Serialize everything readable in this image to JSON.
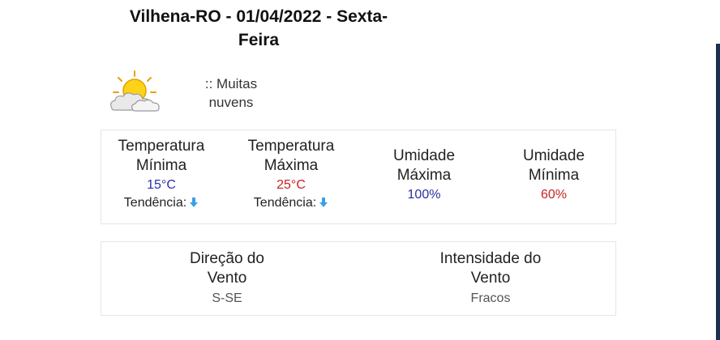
{
  "header": {
    "title_line1": "Vilhena-RO - 01/04/2022 - Sexta-",
    "title_line2": "Feira"
  },
  "condition": {
    "icon": "sun-behind-clouds-icon",
    "line1": ":: Muitas",
    "line2": "nuvens"
  },
  "temperatures": {
    "min": {
      "label_line1": "Temperatura",
      "label_line2": "Mínima",
      "value": "15°C",
      "trend_label": "Tendência:",
      "trend_icon": "arrow-down-icon"
    },
    "max": {
      "label_line1": "Temperatura",
      "label_line2": "Máxima",
      "value": "25°C",
      "trend_label": "Tendência:",
      "trend_icon": "arrow-down-icon"
    }
  },
  "humidity": {
    "max": {
      "label_line1": "Umidade",
      "label_line2": "Máxima",
      "value": "100%"
    },
    "min": {
      "label_line1": "Umidade",
      "label_line2": "Mínima",
      "value": "60%"
    }
  },
  "wind": {
    "direction": {
      "label_line1": "Direção do",
      "label_line2": "Vento",
      "value": "S-SE"
    },
    "intensity": {
      "label_line1": "Intensidade do",
      "label_line2": "Vento",
      "value": "Fracos"
    }
  },
  "colors": {
    "min_value": "#2b2fa6",
    "max_value": "#cc2020",
    "trend_arrow": "#3aa0e6"
  }
}
